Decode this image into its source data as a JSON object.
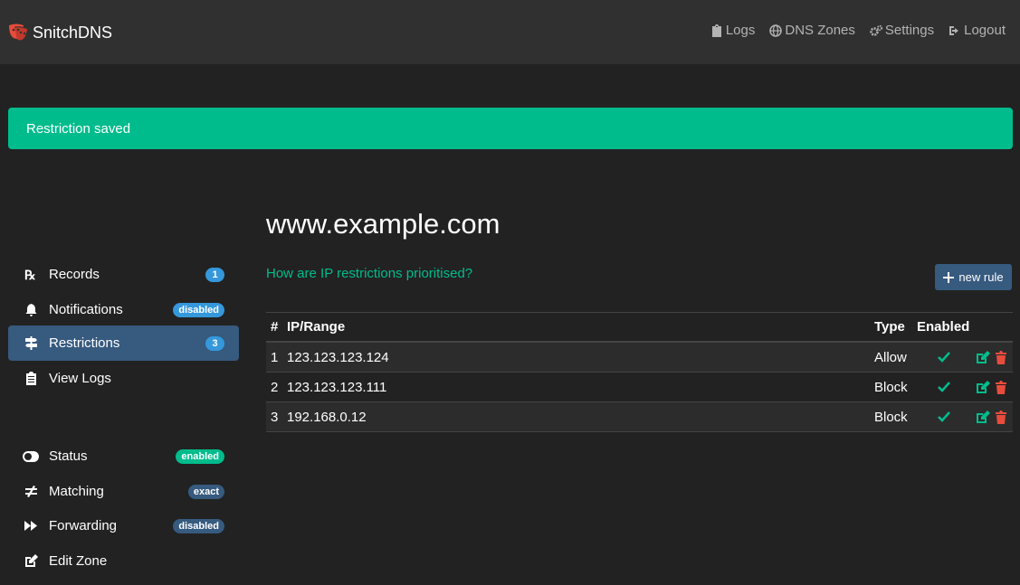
{
  "navbar": {
    "brand": "SnitchDNS",
    "links": [
      {
        "label": "Logs",
        "icon": "clipboard-icon"
      },
      {
        "label": "DNS Zones",
        "icon": "globe-icon"
      },
      {
        "label": "Settings",
        "icon": "gears-icon"
      },
      {
        "label": "Logout",
        "icon": "sign-out-icon"
      }
    ]
  },
  "alert": {
    "message": "Restriction saved"
  },
  "sidebar": {
    "items": [
      {
        "label": "Records",
        "badge": "1",
        "icon": "prescription-icon"
      },
      {
        "label": "Notifications",
        "badge": "disabled",
        "icon": "bell-icon"
      },
      {
        "label": "Restrictions",
        "badge": "3",
        "icon": "signs-icon"
      },
      {
        "label": "View Logs",
        "icon": "clipboard-list-icon"
      },
      {
        "label": "Status",
        "badge": "enabled",
        "icon": "toggle-icon"
      },
      {
        "label": "Matching",
        "badge": "exact",
        "icon": "not-equal-icon"
      },
      {
        "label": "Forwarding",
        "badge": "disabled",
        "icon": "fast-forward-icon"
      },
      {
        "label": "Edit Zone",
        "icon": "edit-icon"
      }
    ]
  },
  "main": {
    "title": "www.example.com",
    "help_link": "How are IP restrictions prioritised?",
    "new_rule_label": "new rule"
  },
  "table": {
    "headers": {
      "num": "#",
      "ip": "IP/Range",
      "type": "Type",
      "enabled": "Enabled"
    },
    "rows": [
      {
        "num": "1",
        "ip": "123.123.123.124",
        "type": "Allow",
        "enabled": true
      },
      {
        "num": "2",
        "ip": "123.123.123.111",
        "type": "Block",
        "enabled": true
      },
      {
        "num": "3",
        "ip": "192.168.0.12",
        "type": "Block",
        "enabled": true
      }
    ]
  },
  "colors": {
    "background": "#222222",
    "navbar": "#303030",
    "success": "#00bc8c",
    "primary": "#375a7f",
    "info": "#3498db",
    "danger": "#e74c3c"
  }
}
